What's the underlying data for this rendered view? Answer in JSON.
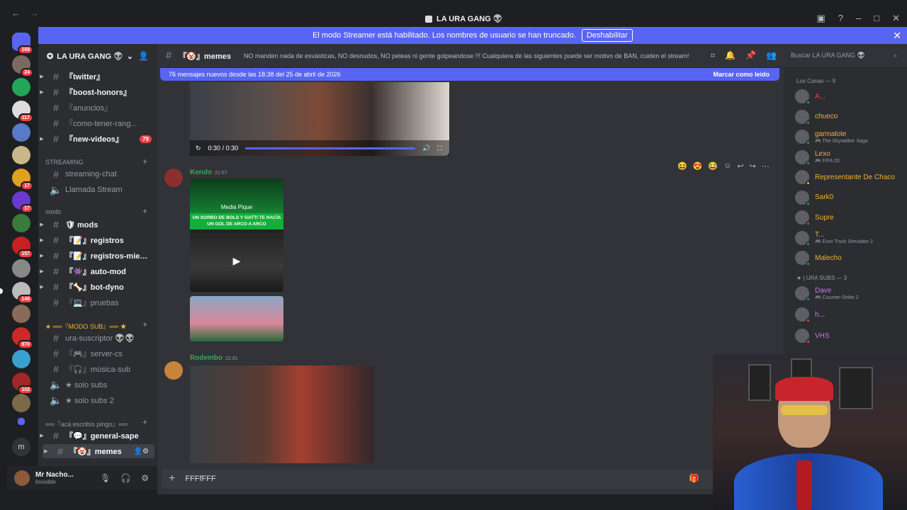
{
  "window": {
    "title": "LA URA GANG 👽",
    "back_icon": "←",
    "forward_icon": "→"
  },
  "streamer_banner": {
    "text": "El modo Streamer está habilitado. Los nombres de usuario se han truncado.",
    "button": "Deshabilitar",
    "close": "✕"
  },
  "servers": [
    {
      "badge": "168"
    },
    {
      "badge": "24"
    },
    {
      "badge": ""
    },
    {
      "badge": "117"
    },
    {
      "badge": ""
    },
    {
      "badge": ""
    },
    {
      "badge": "17"
    },
    {
      "badge": "17"
    },
    {
      "badge": ""
    },
    {
      "badge": "157"
    },
    {
      "badge": ""
    },
    {
      "badge": "148"
    },
    {
      "badge": ""
    },
    {
      "badge": "970"
    },
    {
      "badge": ""
    },
    {
      "badge": "102"
    },
    {
      "badge": ""
    }
  ],
  "guild": {
    "name": "LA URA GANG 👽"
  },
  "channels": {
    "top": [
      {
        "label": "『twitter』",
        "mention": ""
      },
      {
        "label": "『boost-honors』",
        "mention": ""
      },
      {
        "label": "『anuncios』",
        "mention": ""
      },
      {
        "label": "『como-tener-rang...",
        "mention": ""
      },
      {
        "label": "『new-videos』",
        "mention": "79"
      }
    ],
    "streaming_category": "STREAMING",
    "streaming": [
      {
        "label": "streaming-chat"
      },
      {
        "label": "Llamada Stream"
      }
    ],
    "mods_category": "mods",
    "mods": [
      {
        "label": "🛡 mods"
      },
      {
        "label": "『📝』registros"
      },
      {
        "label": "『📝』registros-miem..."
      },
      {
        "label": "『👾』auto-mod"
      },
      {
        "label": "『🦴』bot-dyno"
      },
      {
        "label": "『💻』pruebas"
      }
    ],
    "subs_category": "★ ══『MODO SUB』══ ★",
    "subs": [
      {
        "label": "ura-suscriptor 👽👽"
      },
      {
        "label": "『🎮』server-cs"
      },
      {
        "label": "『🎧』música-sub"
      },
      {
        "label": "★ solo subs"
      },
      {
        "label": "★ solo subs 2"
      }
    ],
    "general_category": "══『acá escribís pingo』══",
    "general": [
      {
        "label": "『💬』general-sape"
      },
      {
        "label": "『🤡』memes"
      }
    ]
  },
  "user_panel": {
    "name": "Mr Nacho...",
    "status": "Invisible"
  },
  "header": {
    "channel": "『🤡』memes",
    "topic": "NO manden nada de esvásticas, NO desnudos, NO peleas ni gente golpeandose !!! Cualquiera de las siguientes puede ser motivo de BAN, cuiden el stream!"
  },
  "search": {
    "placeholder": "Buscar LA URA GANG 👽"
  },
  "new_messages_bar": {
    "text": "76 mensajes nuevos desde las 18:38 del 25 de abril de 2026",
    "action": "Marcar como leído"
  },
  "video1": {
    "time": "0:30 / 0:30"
  },
  "messages": [
    {
      "author": "Kendo",
      "time": "21:57",
      "card_logo": "Media Pique",
      "card_text": "UN SORBO DE BOLS Y GATTI TE HACÍA UN GOL DE ARCO A ARCO"
    },
    {
      "author": "Rodembo",
      "time": "22:01"
    }
  ],
  "composer": {
    "value": "FFFfFFF"
  },
  "members": {
    "group1": "Los Canas — 9",
    "group1_members": [
      {
        "name": "A...",
        "activity": "",
        "color": "#f23f43",
        "status": "#23a55a"
      },
      {
        "name": "chueco",
        "activity": "",
        "color": "#f0b232",
        "status": "#23a55a"
      },
      {
        "name": "garmalote",
        "activity": "🎮 The Skywalker Saga",
        "color": "#f0b232",
        "status": "#23a55a"
      },
      {
        "name": "Lexo",
        "activity": "🎮 FIFA 20",
        "color": "#f0b232",
        "status": "#23a55a"
      },
      {
        "name": "Representante De Chaco",
        "activity": "",
        "color": "#f0b232",
        "status": "#f0b232"
      },
      {
        "name": "Sark0",
        "activity": "",
        "color": "#f0b232",
        "status": "#23a55a"
      },
      {
        "name": "Supre",
        "activity": "",
        "color": "#f0b232",
        "status": "#f23f43"
      },
      {
        "name": "T...",
        "activity": "🎮 Euro Truck Simulator 2",
        "color": "#f0b232",
        "status": "#23a55a"
      },
      {
        "name": "Malecho",
        "activity": "",
        "color": "#f0b232",
        "status": "#23a55a"
      }
    ],
    "group2": "★ | URA SUBS — 3",
    "group2_members": [
      {
        "name": "Dave",
        "activity": "🎮 Counter-Strike 2",
        "color": "#c27ae8",
        "status": "#23a55a"
      },
      {
        "name": "h...",
        "activity": "",
        "color": "#c27ae8",
        "status": "#f23f43"
      },
      {
        "name": "VHS",
        "activity": "",
        "color": "#c27ae8",
        "status": "#f23f43"
      }
    ]
  },
  "colors": {
    "accent": "#5865f2",
    "online": "#23a55a",
    "dnd": "#f23f43",
    "idle": "#f0b232"
  }
}
